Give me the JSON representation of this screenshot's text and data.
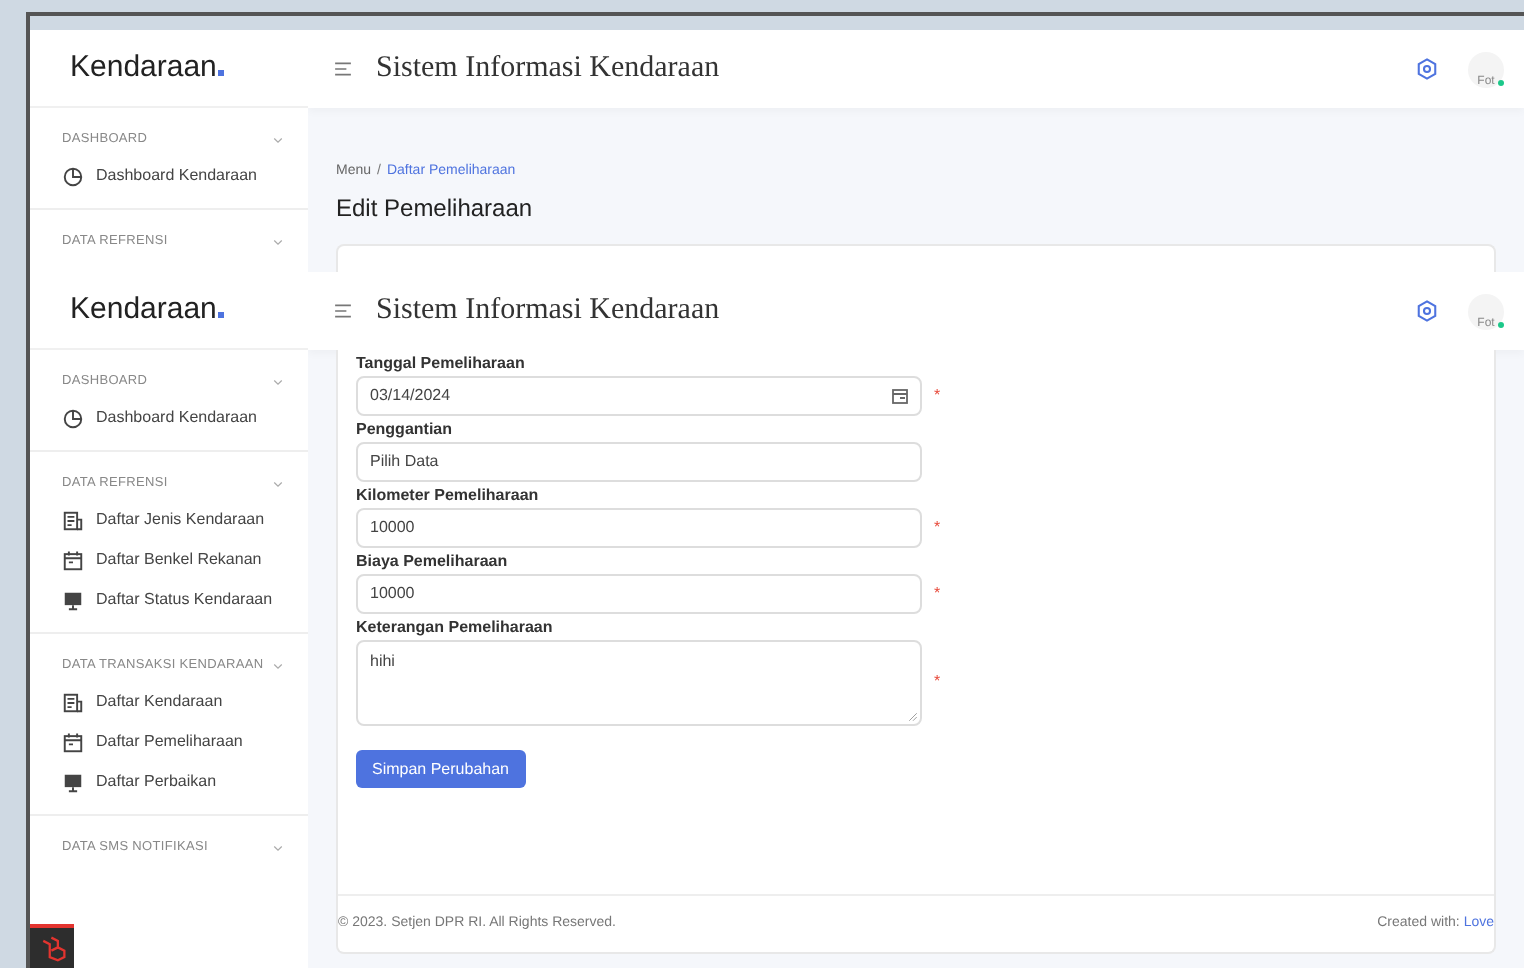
{
  "segments": [
    {
      "sidebar": {
        "logo": "Kendaraan",
        "sections": [
          {
            "title": "DASHBOARD",
            "items": [
              {
                "label": "Dashboard Kendaraan",
                "kind": "pie"
              }
            ]
          },
          {
            "title": "DATA REFRENSI"
          }
        ]
      },
      "header": {
        "title": "Sistem Informasi Kendaraan",
        "avatar_text": "Fot"
      },
      "breadcrumb": [
        {
          "label": "Menu",
          "link": false
        },
        {
          "separator": "/",
          "label": "Daftar Pemeliharaan",
          "link": true
        }
      ],
      "page_title": "Edit Pemeliharaan"
    },
    {
      "sidebar": {
        "logo": "Kendaraan",
        "sections": [
          {
            "title": "DASHBOARD",
            "items": [
              {
                "label": "Dashboard Kendaraan",
                "kind": "pie"
              }
            ]
          },
          {
            "title": "DATA REFRENSI",
            "items": [
              {
                "label": "Daftar Jenis Kendaraan",
                "kind": "list"
              },
              {
                "label": "Daftar Benkel Rekanan",
                "kind": "calendar"
              },
              {
                "label": "Daftar Status Kendaraan",
                "kind": "monitor"
              }
            ]
          },
          {
            "title": "DATA TRANSAKSI KENDARAAN",
            "items": [
              {
                "label": "Daftar Kendaraan",
                "kind": "list"
              },
              {
                "label": "Daftar Pemeliharaan",
                "kind": "calendar"
              },
              {
                "label": "Daftar Perbaikan",
                "kind": "monitor"
              }
            ]
          },
          {
            "title": "DATA SMS NOTIFIKASI"
          }
        ]
      },
      "header": {
        "title": "Sistem Informasi Kendaraan",
        "avatar_text": "Fot"
      },
      "form": {
        "fields": [
          {
            "label": "Tanggal Pemeliharaan",
            "kind": "date",
            "value": "03/14/2024",
            "required_mark": "*"
          },
          {
            "label": "Penggantian",
            "kind": "text",
            "value": "Pilih Data"
          },
          {
            "label": "Kilometer Pemeliharaan",
            "kind": "text",
            "value": "10000",
            "required_mark": "*"
          },
          {
            "label": "Biaya Pemeliharaan",
            "kind": "text",
            "value": "10000",
            "required_mark": "*"
          },
          {
            "label": "Keterangan Pemeliharaan",
            "kind": "textarea",
            "value": "hihi",
            "required_mark": "*"
          }
        ],
        "submit": "Simpan Perubahan"
      },
      "footer": {
        "copyright": "© 2023. Setjen DPR RI. All Rights Reserved.",
        "credit": "Created with:",
        "credit_link": "Love"
      }
    }
  ]
}
